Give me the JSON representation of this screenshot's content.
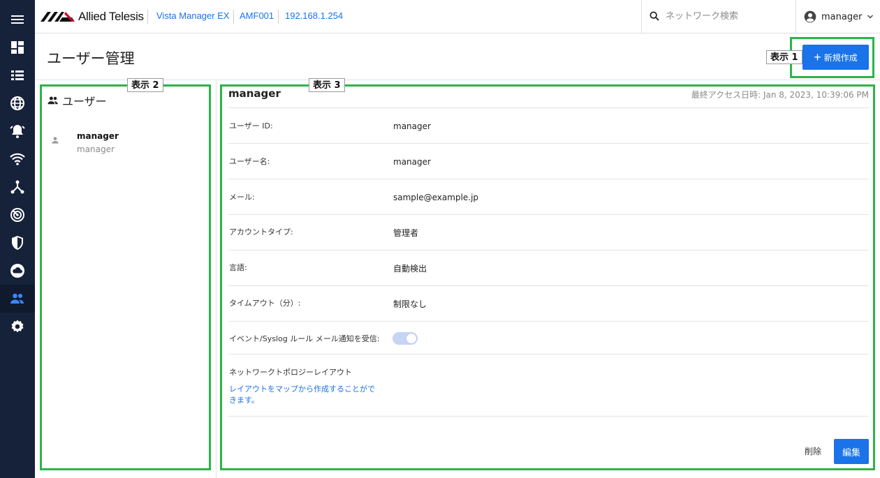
{
  "topbar": {
    "brand": "Allied Telesis",
    "product": "Vista Manager EX",
    "device": "AMF001",
    "ip": "192.168.1.254",
    "search_placeholder": "ネットワーク検索",
    "user": "manager"
  },
  "nav": {
    "items": [
      "menu-icon",
      "dashboard-icon",
      "list-icon",
      "globe-icon",
      "alarm-icon",
      "wifi-icon",
      "topology-icon",
      "radar-icon",
      "shield-icon",
      "cloud-icon",
      "users-icon",
      "settings-icon"
    ],
    "active": "users-icon"
  },
  "page": {
    "title": "ユーザー管理",
    "create_label": "新規作成",
    "callout1": "表示 1",
    "callout2": "表示 2",
    "callout3": "表示 3"
  },
  "users_panel": {
    "title": "ユーザー",
    "users": [
      {
        "primary": "manager",
        "secondary": "manager"
      }
    ]
  },
  "detail": {
    "name": "manager",
    "last_access": "最終アクセス日時: Jan 8, 2023, 10:39:06 PM",
    "fields": [
      {
        "label": "ユーザー ID:",
        "value": "manager"
      },
      {
        "label": "ユーザー名:",
        "value": "manager"
      },
      {
        "label": "メール:",
        "value": "sample@example.jp"
      },
      {
        "label": "アカウントタイプ:",
        "value": "管理者"
      },
      {
        "label": "言語:",
        "value": "自動検出"
      },
      {
        "label": "タイムアウト（分）:",
        "value": "制限なし"
      }
    ],
    "notify_label": "イベント/Syslog ルール メール通知を受信:",
    "notify_enabled": true,
    "layout_label": "ネットワークトポロジーレイアウト",
    "layout_link": "レイアウトをマップから作成することができます。",
    "delete_label": "削除",
    "edit_label": "編集"
  },
  "colors": {
    "accent": "#1a73e8",
    "sidebar": "#16213a",
    "callout_frame": "#2db34a"
  }
}
